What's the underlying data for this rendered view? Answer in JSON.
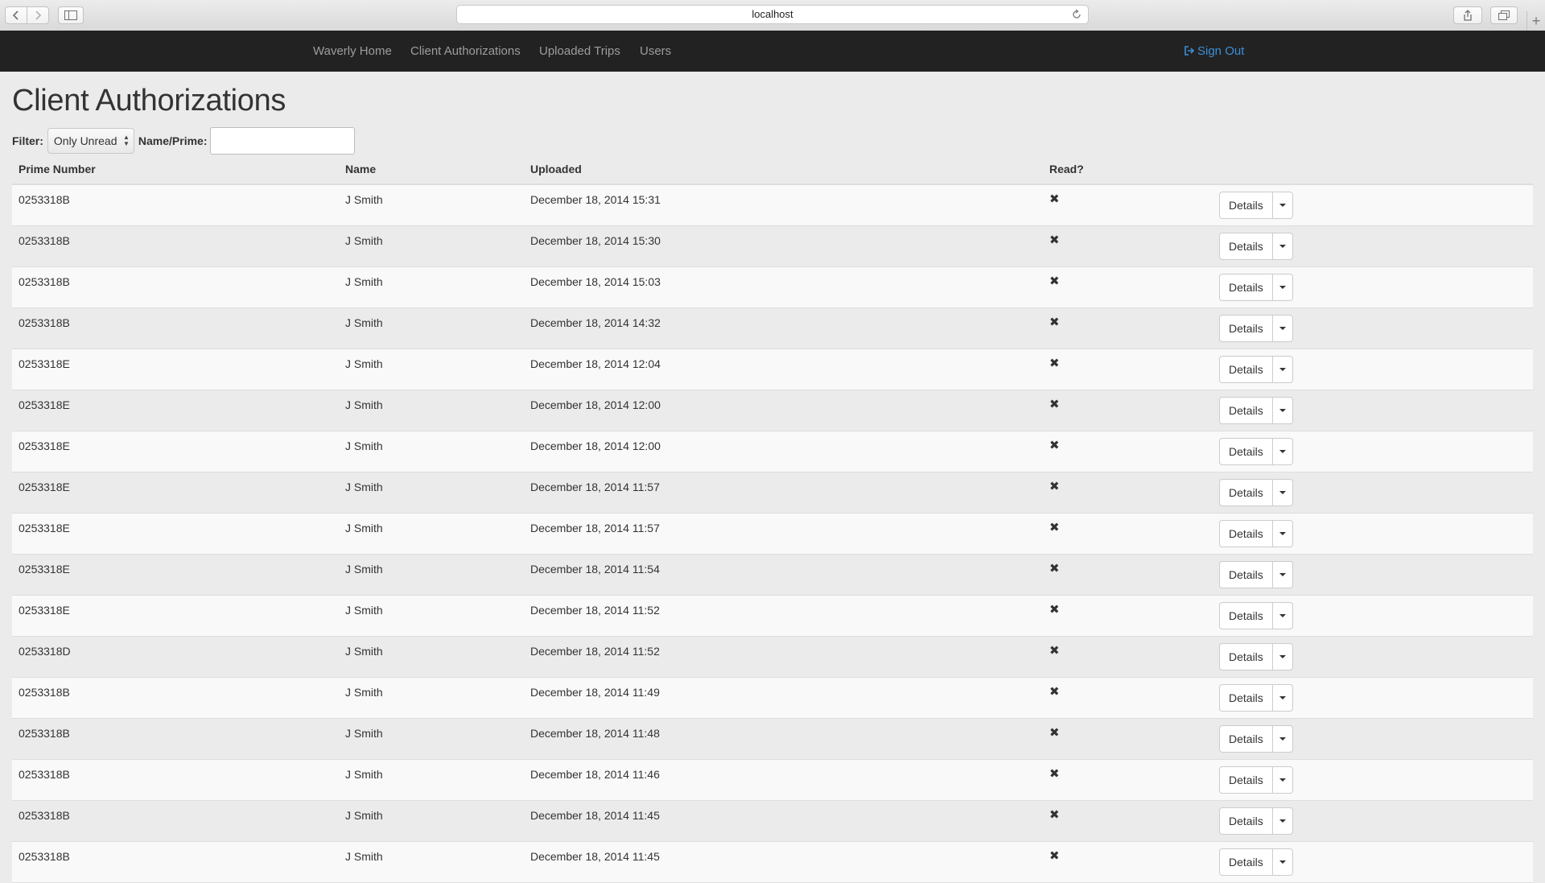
{
  "browser": {
    "url": "localhost"
  },
  "navbar": {
    "links": [
      "Waverly Home",
      "Client Authorizations",
      "Uploaded Trips",
      "Users"
    ],
    "sign_out": "Sign Out"
  },
  "page": {
    "title": "Client Authorizations",
    "filter_label": "Filter:",
    "filter_value": "Only Unread",
    "name_prime_label": "Name/Prime:",
    "name_prime_value": ""
  },
  "table": {
    "headers": [
      "Prime Number",
      "Name",
      "Uploaded",
      "Read?"
    ],
    "details_label": "Details",
    "read_mark": "✖",
    "rows": [
      {
        "prime": "0253318B",
        "name": "J Smith",
        "uploaded": "December 18, 2014 15:31"
      },
      {
        "prime": "0253318B",
        "name": "J Smith",
        "uploaded": "December 18, 2014 15:30"
      },
      {
        "prime": "0253318B",
        "name": "J Smith",
        "uploaded": "December 18, 2014 15:03"
      },
      {
        "prime": "0253318B",
        "name": "J Smith",
        "uploaded": "December 18, 2014 14:32"
      },
      {
        "prime": "0253318E",
        "name": "J Smith",
        "uploaded": "December 18, 2014 12:04"
      },
      {
        "prime": "0253318E",
        "name": "J Smith",
        "uploaded": "December 18, 2014 12:00"
      },
      {
        "prime": "0253318E",
        "name": "J Smith",
        "uploaded": "December 18, 2014 12:00"
      },
      {
        "prime": "0253318E",
        "name": "J Smith",
        "uploaded": "December 18, 2014 11:57"
      },
      {
        "prime": "0253318E",
        "name": "J Smith",
        "uploaded": "December 18, 2014 11:57"
      },
      {
        "prime": "0253318E",
        "name": "J Smith",
        "uploaded": "December 18, 2014 11:54"
      },
      {
        "prime": "0253318E",
        "name": "J Smith",
        "uploaded": "December 18, 2014 11:52"
      },
      {
        "prime": "0253318D",
        "name": "J Smith",
        "uploaded": "December 18, 2014 11:52"
      },
      {
        "prime": "0253318B",
        "name": "J Smith",
        "uploaded": "December 18, 2014 11:49"
      },
      {
        "prime": "0253318B",
        "name": "J Smith",
        "uploaded": "December 18, 2014 11:48"
      },
      {
        "prime": "0253318B",
        "name": "J Smith",
        "uploaded": "December 18, 2014 11:46"
      },
      {
        "prime": "0253318B",
        "name": "J Smith",
        "uploaded": "December 18, 2014 11:45"
      },
      {
        "prime": "0253318B",
        "name": "J Smith",
        "uploaded": "December 18, 2014 11:45"
      }
    ]
  }
}
